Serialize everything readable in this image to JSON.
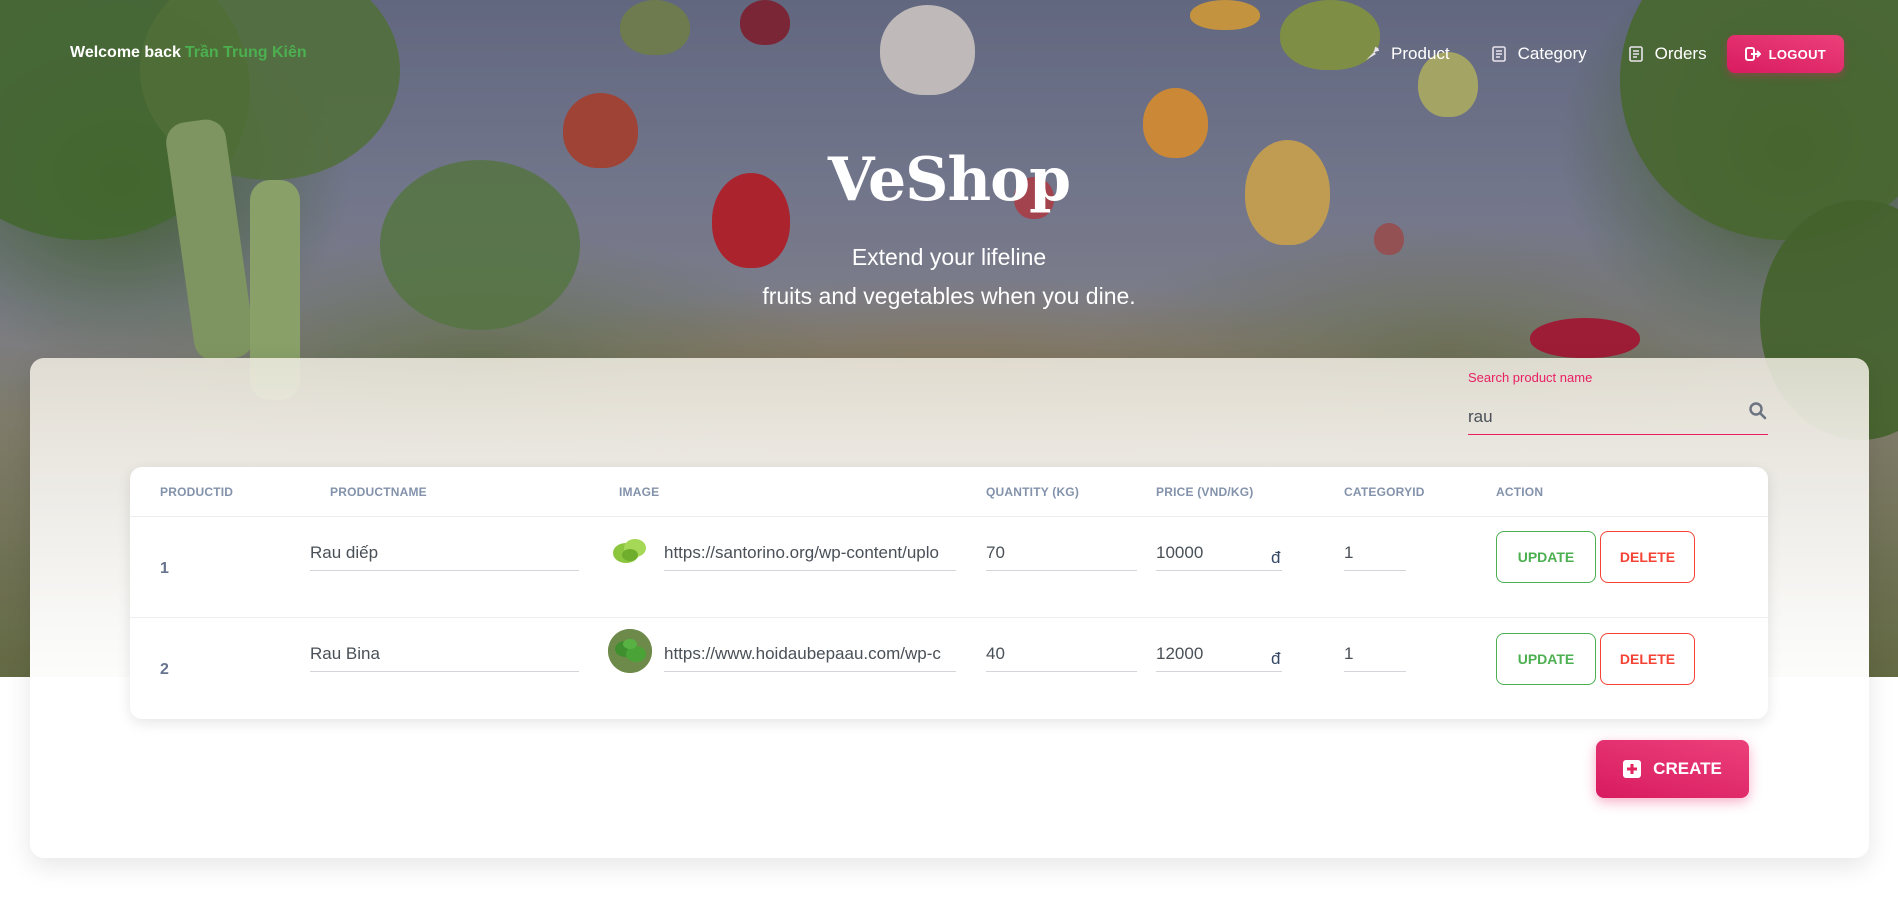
{
  "header": {
    "welcome_text": "Welcome back",
    "user_name": "Trần Trung Kiên",
    "nav": [
      {
        "label": "Product",
        "icon": "carrot-icon"
      },
      {
        "label": "Category",
        "icon": "receipt-icon"
      },
      {
        "label": "Orders",
        "icon": "receipt-icon"
      }
    ],
    "logout_label": "LOGOUT"
  },
  "hero": {
    "brand": "VeShop",
    "tagline_line1": "Extend your lifeline",
    "tagline_line2": "fruits and vegetables when you dine."
  },
  "search": {
    "label": "Search product name",
    "value": "rau"
  },
  "table": {
    "columns": [
      "PRODUCTID",
      "PRODUCTNAME",
      "IMAGE",
      "QUANTITY (KG)",
      "PRICE (VND/KG)",
      "CATEGORYID",
      "ACTION"
    ],
    "currency_symbol": "đ",
    "rows": [
      {
        "id": "1",
        "name": "Rau diếp",
        "image_url": "https://santorino.org/wp-content/uplo",
        "quantity": "70",
        "price": "10000",
        "category_id": "1"
      },
      {
        "id": "2",
        "name": "Rau Bina",
        "image_url": "https://www.hoidaubepaau.com/wp-c",
        "quantity": "40",
        "price": "12000",
        "category_id": "1"
      }
    ],
    "update_label": "UPDATE",
    "delete_label": "DELETE"
  },
  "create_label": "CREATE",
  "colors": {
    "accent": "#e91e63",
    "success": "#4caf50",
    "danger": "#f44335"
  }
}
